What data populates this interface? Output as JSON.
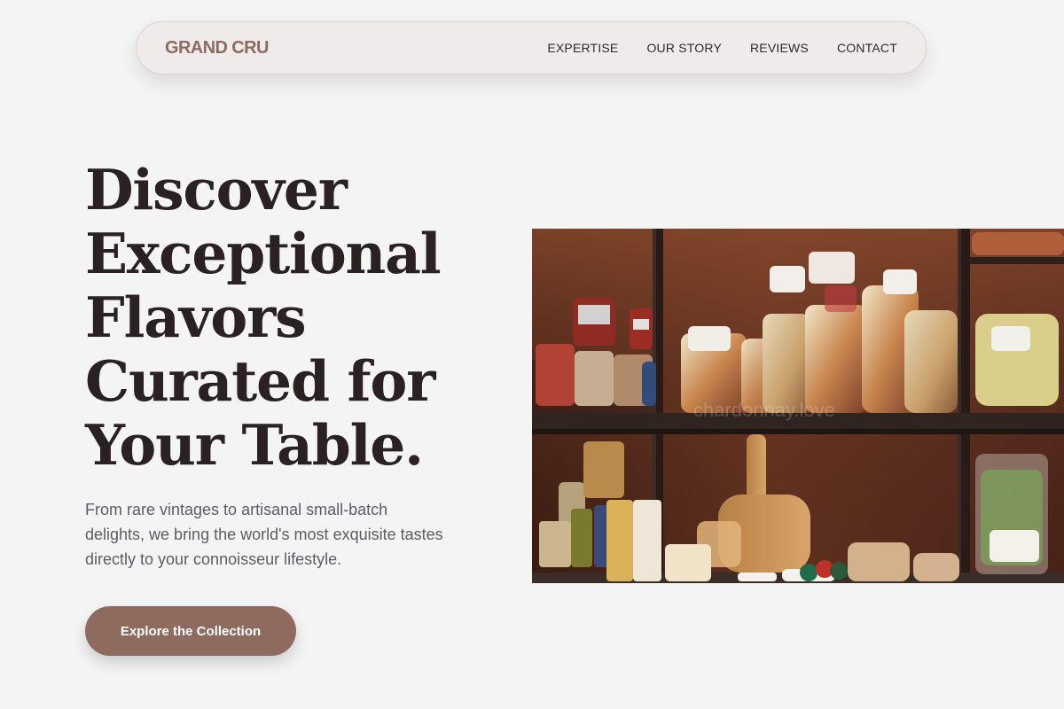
{
  "brand": {
    "name": "GRAND CRU"
  },
  "nav": {
    "items": [
      {
        "label": "EXPERTISE"
      },
      {
        "label": "OUR STORY"
      },
      {
        "label": "REVIEWS"
      },
      {
        "label": "CONTACT"
      }
    ]
  },
  "hero": {
    "title_lines": [
      "Discover",
      "Exceptional",
      "Flavors",
      "Curated for",
      "Your Table."
    ],
    "subtitle": "From rare vintages to artisanal small-batch delights, we bring the world's most exquisite tastes directly to your connoisseur lifestyle.",
    "cta_label": "Explore the Collection"
  },
  "image": {
    "watermark": "chardonnay.love"
  },
  "colors": {
    "page_background": "#f4f4f4",
    "brand": "#8c6b60",
    "cta_background": "#8f6a5e",
    "title_text": "#2a2222",
    "body_text": "#5b5d66"
  }
}
